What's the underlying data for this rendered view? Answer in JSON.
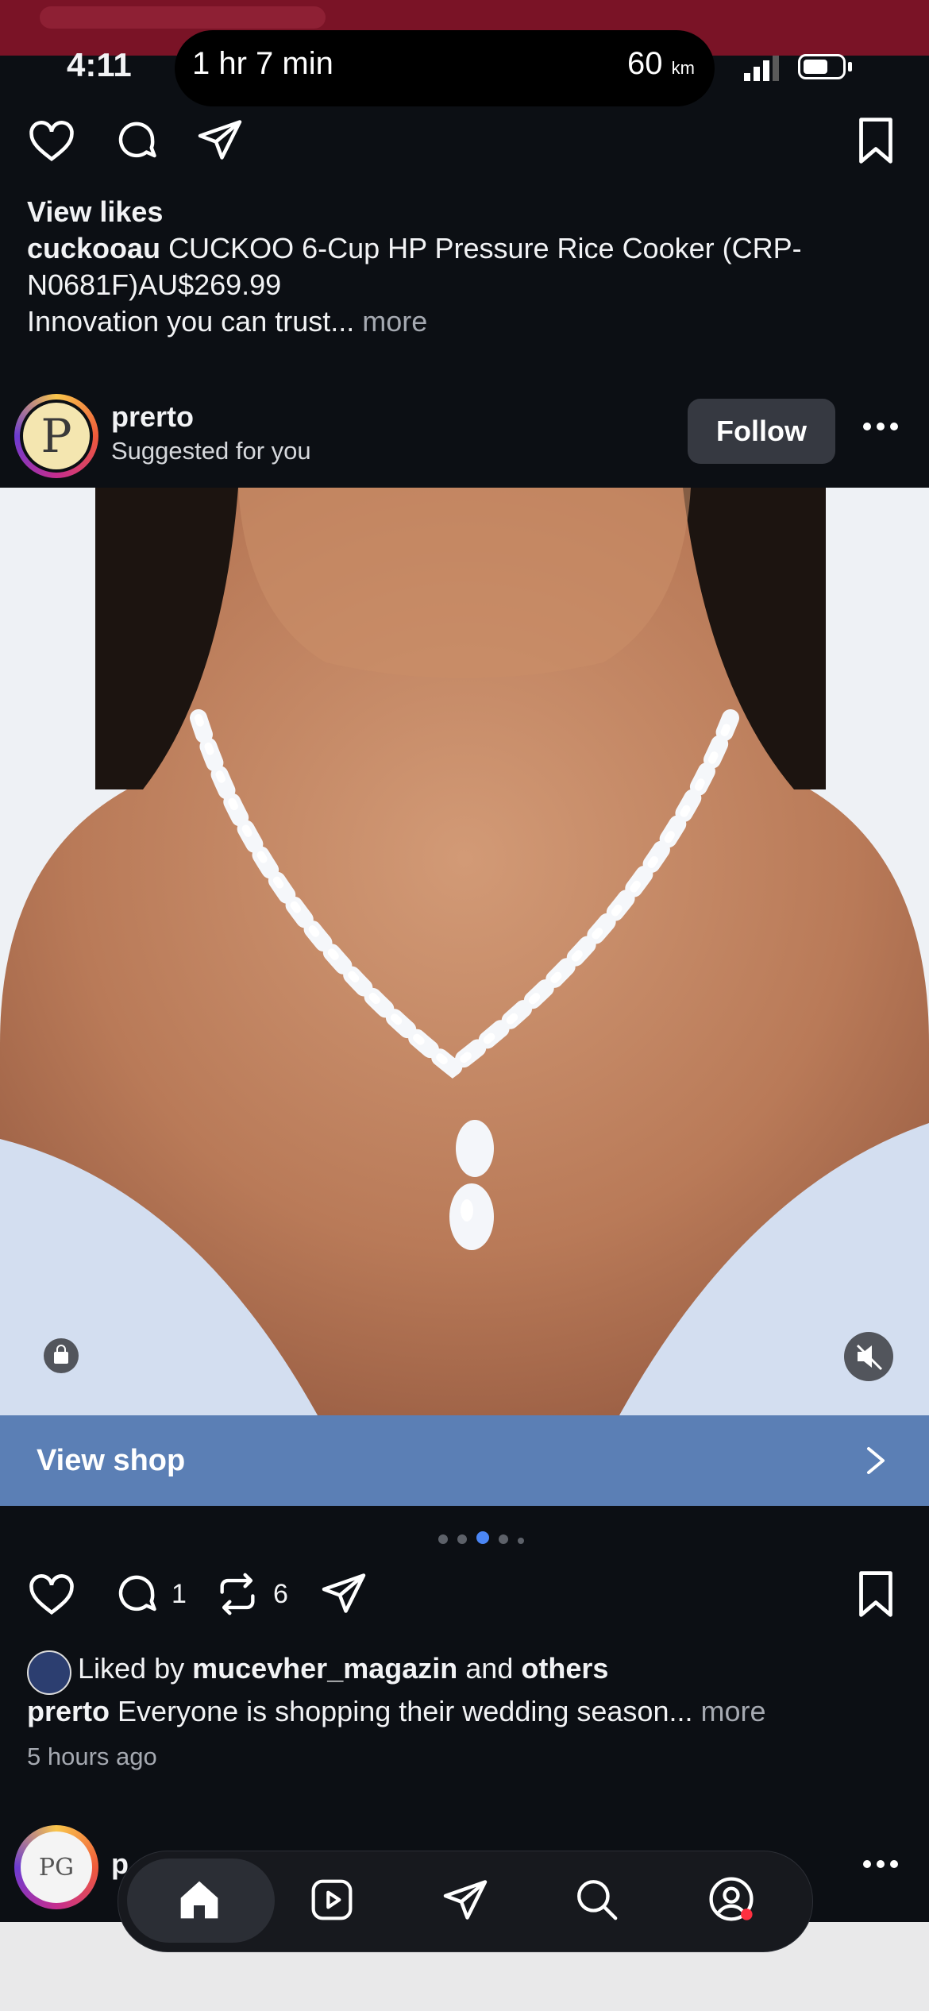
{
  "status_bar": {
    "time": "4:11",
    "trip_duration": "1 hr 7 min",
    "distance_value": "60",
    "distance_unit": "km"
  },
  "previous_post": {
    "view_likes": "View likes",
    "username": "cuckooau",
    "caption_line1": "CUCKOO 6-Cup HP Pressure Rice Cooker (CRP-",
    "caption_line2": "N0681F)AU$269.99",
    "caption_line3": "Innovation you can trust...",
    "more": "more"
  },
  "post": {
    "username": "prerto",
    "subtitle": "Suggested for you",
    "avatar_letter": "P",
    "follow_label": "Follow",
    "view_shop_label": "View shop",
    "comment_count": "1",
    "repost_count": "6",
    "liked_by_prefix": "Liked by",
    "liked_by_user": "mucevher_magazin",
    "liked_by_and": "and",
    "liked_by_others": "others",
    "caption_user": "prerto",
    "caption_text": "Everyone is shopping their wedding season...",
    "caption_more": "more",
    "time_ago": "5 hours ago",
    "carousel_count": 5,
    "carousel_active": 3
  },
  "next_post": {
    "avatar_text": "PG",
    "username_partial": "p"
  },
  "icons": [
    "heart-icon",
    "comment-icon",
    "share-icon",
    "bookmark-icon",
    "repost-icon",
    "more-icon",
    "shop-bag-icon",
    "mute-icon",
    "chevron-right-icon",
    "home-icon",
    "reels-icon",
    "search-icon",
    "profile-icon"
  ],
  "colors": {
    "background": "#0c0f14",
    "view_shop_bar": "#5b7fb5",
    "carousel_active_dot": "#4b86f5",
    "follow_button": "#363941"
  }
}
